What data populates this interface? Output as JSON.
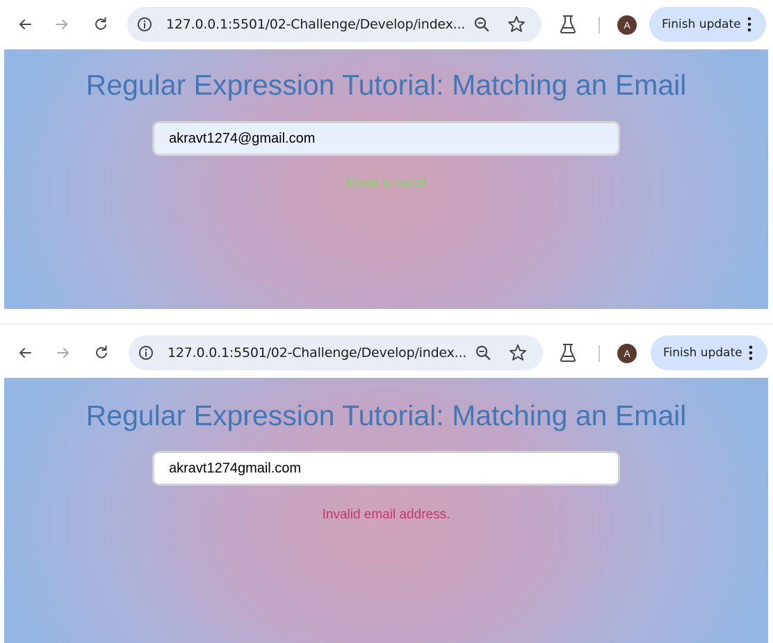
{
  "screens": [
    {
      "browser": {
        "url": "127.0.0.1:5501/02-Challenge/Develop/index...",
        "profile_initial": "A",
        "update_button_label": "Finish update"
      },
      "page": {
        "title": "Regular Expression Tutorial: Matching an Email",
        "email_value": "akravt1274@gmail.com",
        "message": "Email is valid!",
        "message_color": "#7ed36a"
      }
    },
    {
      "browser": {
        "url": "127.0.0.1:5501/02-Challenge/Develop/index...",
        "profile_initial": "A",
        "update_button_label": "Finish update"
      },
      "page": {
        "title": "Regular Expression Tutorial: Matching an Email",
        "email_value": "akravt1274gmail.com",
        "message": "Invalid email address.",
        "message_color": "#c2396d"
      }
    }
  ],
  "colors": {
    "title": "#4477b6",
    "toolbar_bg": "#ffffff",
    "omnibox_bg": "#e9eef6",
    "finish_button_bg": "#d3e3fd",
    "avatar_bg": "#5d3a2f"
  },
  "icons": {
    "back": "arrow-left-icon",
    "forward": "arrow-right-icon",
    "reload": "reload-icon",
    "site_info": "info-circle-icon",
    "zoom": "zoom-out-icon",
    "bookmark": "star-icon",
    "labs": "flask-icon",
    "menu": "three-dots-vertical-icon"
  }
}
